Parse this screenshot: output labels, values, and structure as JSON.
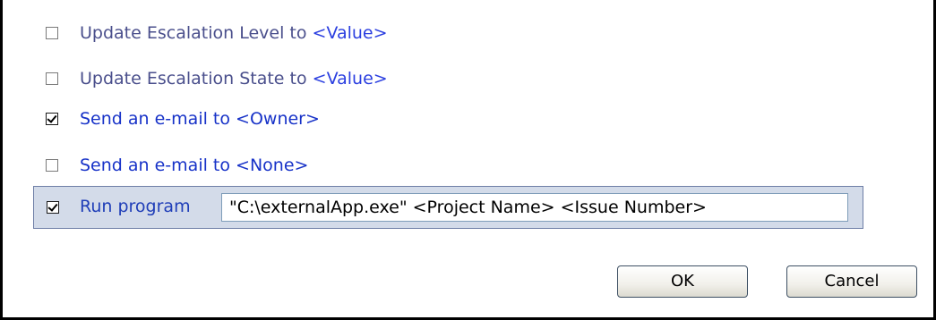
{
  "options": [
    {
      "label_text": "Update Escalation Level to ",
      "value_text": "<Value>",
      "checked": false
    },
    {
      "label_text": "Update Escalation State to ",
      "value_text": "<Value>",
      "checked": false
    },
    {
      "label_text": "Send an e-mail to <Owner>",
      "value_text": "",
      "checked": true
    },
    {
      "label_text": "Send an e-mail to <None>",
      "value_text": "",
      "checked": false
    }
  ],
  "run_program": {
    "label": "Run program",
    "checked": true,
    "command": "\"C:\\externalApp.exe\" <Project Name> <Issue Number>"
  },
  "buttons": {
    "ok_label": "OK",
    "cancel_label": "Cancel"
  },
  "colors": {
    "label_gray": "#4a4f8c",
    "label_blue": "#1732c8",
    "run_box_bg": "#d3dbe9"
  }
}
